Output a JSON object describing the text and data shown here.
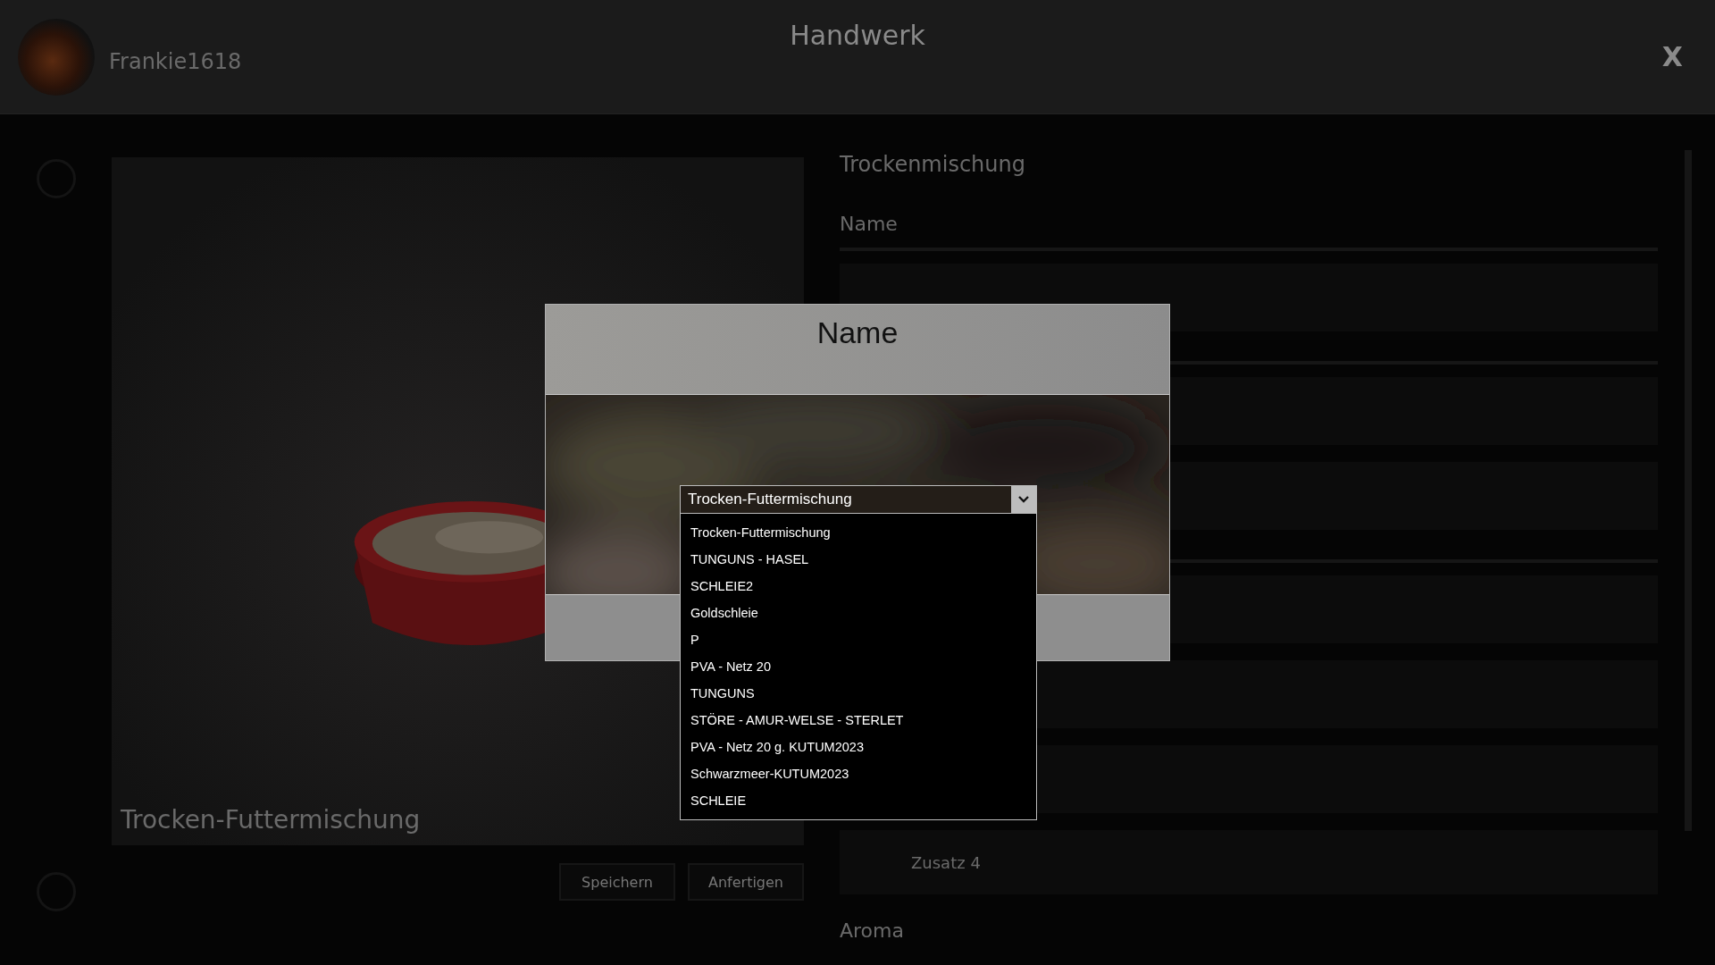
{
  "header": {
    "user_name": "Frankie1618",
    "title": "Handwerk",
    "close_label": "X"
  },
  "preview": {
    "kind": "picture",
    "caption": "Trocken-Futtermischung",
    "buttons": [
      "Speichern",
      "Anfertigen"
    ]
  },
  "details": {
    "title": "Trockenmischung",
    "name_label": "Name",
    "extra_label": "Zusatz 4",
    "aroma_label": "Aroma"
  },
  "dialog": {
    "title": "Name",
    "kind": "picture",
    "dropdown": {
      "value": "Trocken-Futtermischung",
      "expanded": true,
      "options": [
        "Trocken-Futtermischung",
        "TUNGUNS - HASEL",
        "SCHLEIE2",
        "Goldschleie",
        "P",
        "PVA - Netz 20",
        "TUNGUNS",
        "STÖRE - AMUR-WELSE - STERLET",
        "PVA - Netz 20 g. KUTUM2023",
        "Schwarzmeer-KUTUM2023",
        "SCHLEIE"
      ]
    }
  }
}
